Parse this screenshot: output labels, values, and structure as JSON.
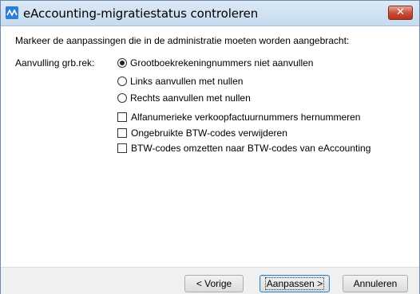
{
  "window": {
    "title": "eAccounting-migratiestatus controleren",
    "app_icon": "eaccounting-logo-icon",
    "close_label": "✕"
  },
  "content": {
    "instruction": "Markeer de aanpassingen die in de administratie moeten worden aangebracht:",
    "group_label": "Aanvulling grb.rek:",
    "radio_options": [
      {
        "label": "Grootboekrekeningnummers niet aanvullen",
        "checked": true
      },
      {
        "label": "Links aanvullen met nullen",
        "checked": false
      },
      {
        "label": "Rechts aanvullen met nullen",
        "checked": false
      }
    ],
    "checkbox_options": [
      {
        "label": "Alfanumerieke verkoopfactuurnummers hernummeren",
        "checked": false
      },
      {
        "label": "Ongebruikte BTW-codes verwijderen",
        "checked": false
      },
      {
        "label": "BTW-codes omzetten naar BTW-codes van eAccounting",
        "checked": false
      }
    ]
  },
  "footer": {
    "back_label": "< Vorige",
    "apply_label": "Aanpassen >",
    "cancel_label": "Annuleren"
  }
}
